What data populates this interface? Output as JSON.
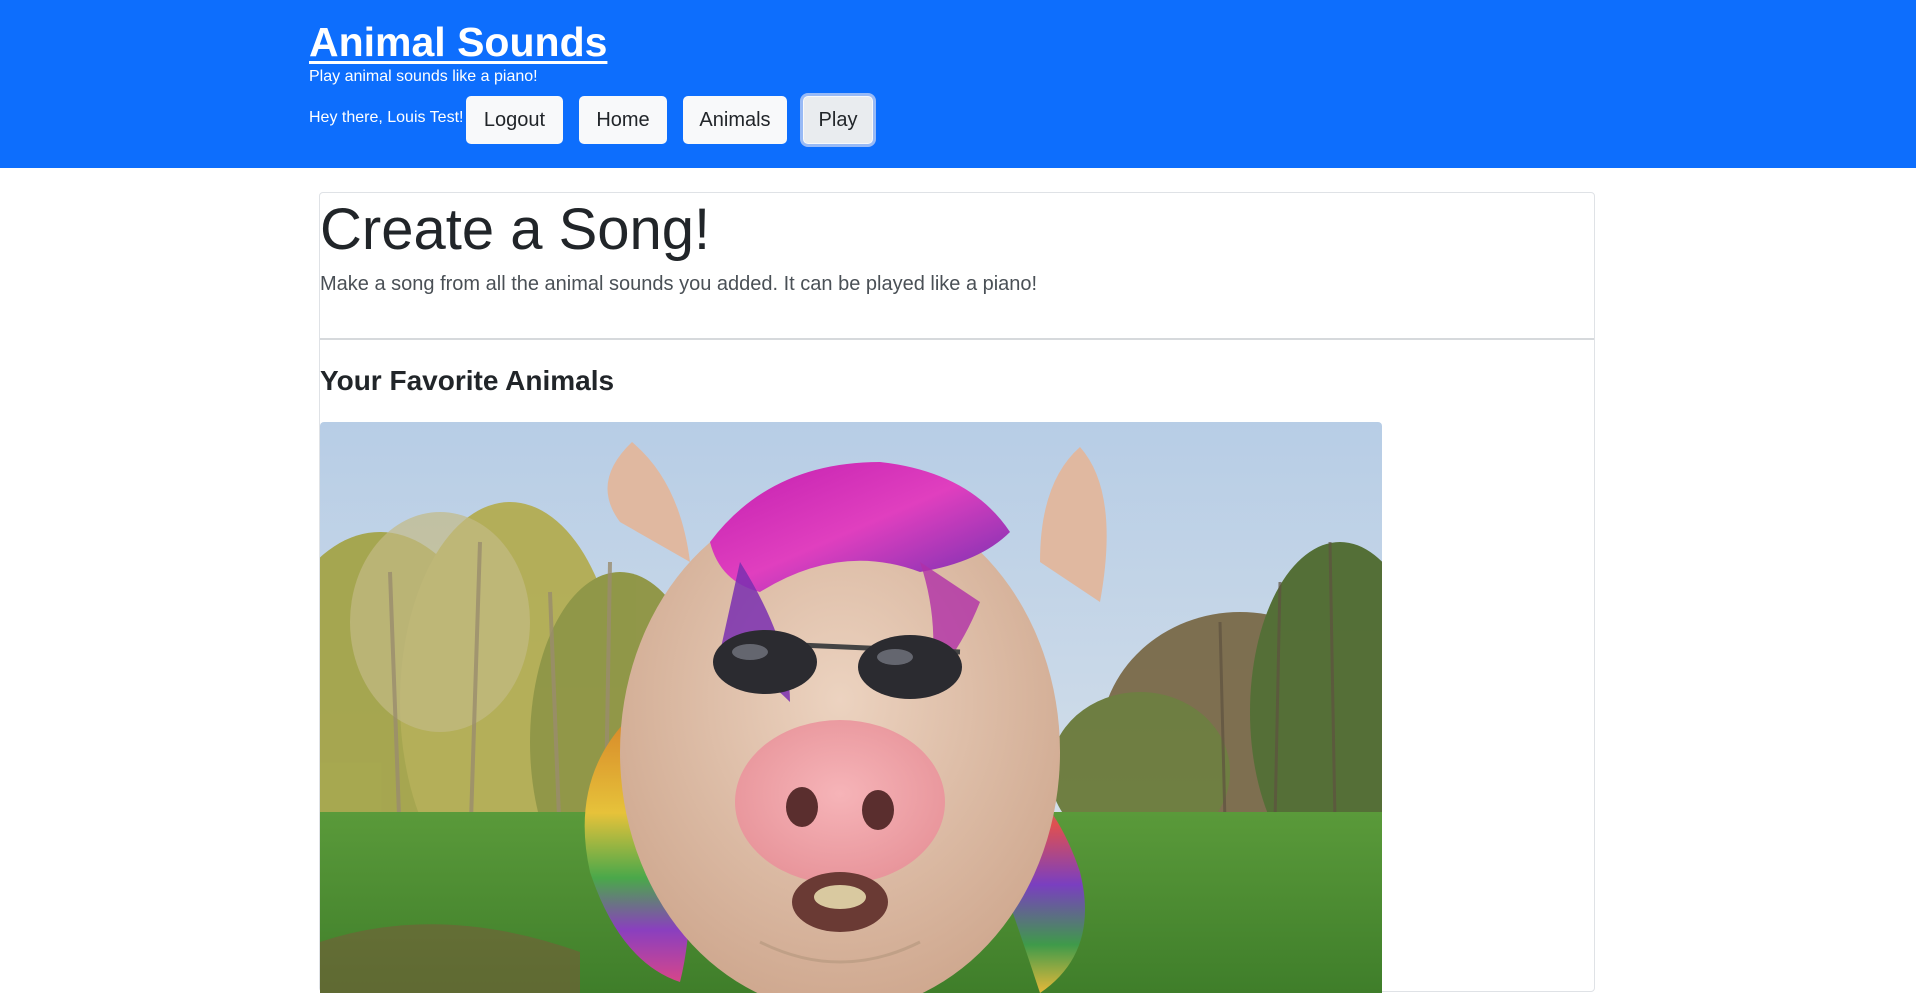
{
  "header": {
    "brand_title": "Animal Sounds",
    "tagline": "Play animal sounds like a piano!",
    "greeting": "Hey there, Louis Test!",
    "nav": {
      "logout": "Logout",
      "home": "Home",
      "animals": "Animals",
      "play": "Play"
    },
    "active_nav": "Play",
    "header_color": "#0d6efd"
  },
  "main": {
    "hero_title": "Create a Song!",
    "hero_lead": "Make a song from all the animal sounds you added. It can be played like a piano!",
    "section_title": "Your Favorite Animals",
    "favorite_animals": [
      {
        "image": "pig-with-rainbow-wig-and-sunglasses-photo"
      }
    ]
  }
}
